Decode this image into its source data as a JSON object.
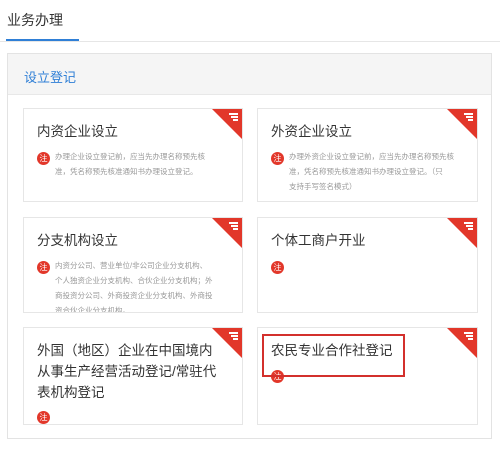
{
  "tabs": {
    "active_label": "业务办理"
  },
  "panel": {
    "title": "设立登记"
  },
  "note_label": "注",
  "cards": [
    {
      "title": "内资企业设立",
      "desc": [
        "办理企业设立登记前，应当先办理名称预先核",
        "准，凭名称预先核准通知书办理设立登记。"
      ]
    },
    {
      "title": "外资企业设立",
      "desc": [
        "办理外资企业设立登记前，应当先办理名称预先核",
        "准，凭名称预先核准通知书办理设立登记。（只",
        "支持手写签名模式）"
      ]
    },
    {
      "title": "分支机构设立",
      "desc": [
        "内资分公司、营业单位/非公司企业分支机构、",
        "个人独资企业分支机构、合伙企业分支机构；外",
        "商投资分公司、外商投资企业分支机构、外商投",
        "资合伙企业分支机构。"
      ]
    },
    {
      "title": "个体工商户开业",
      "desc": []
    },
    {
      "title": "外国（地区）企业在中国境内从事生产经营活动登记/常驻代表机构登记",
      "desc": []
    },
    {
      "title": "农民专业合作社登记",
      "desc": []
    }
  ],
  "colors": {
    "accent": "#2f7fd6",
    "badge": "#e2372a",
    "highlight": "#d3302c"
  }
}
